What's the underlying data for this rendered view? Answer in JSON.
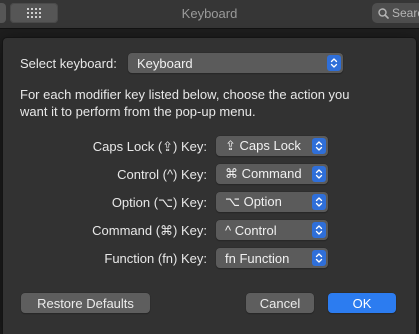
{
  "window": {
    "title": "Keyboard",
    "search_placeholder": "Search"
  },
  "dialog": {
    "select_keyboard_label": "Select keyboard:",
    "select_keyboard_value": "Keyboard",
    "description_line1": "For each modifier key listed below, choose the action you",
    "description_line2": "want it to perform from the pop-up menu.",
    "modifiers": [
      {
        "label": "Caps Lock (⇪) Key:",
        "value": "⇪ Caps Lock"
      },
      {
        "label": "Control (^) Key:",
        "value": "⌘ Command"
      },
      {
        "label": "Option (⌥) Key:",
        "value": "⌥ Option"
      },
      {
        "label": "Command (⌘) Key:",
        "value": "^ Control"
      },
      {
        "label": "Function (fn) Key:",
        "value": "fn Function"
      }
    ],
    "restore_defaults_label": "Restore Defaults",
    "cancel_label": "Cancel",
    "ok_label": "OK"
  },
  "colors": {
    "accent": "#2c7cf0",
    "sheet_bg": "#323232",
    "popup_bg": "#5b5b5b"
  }
}
